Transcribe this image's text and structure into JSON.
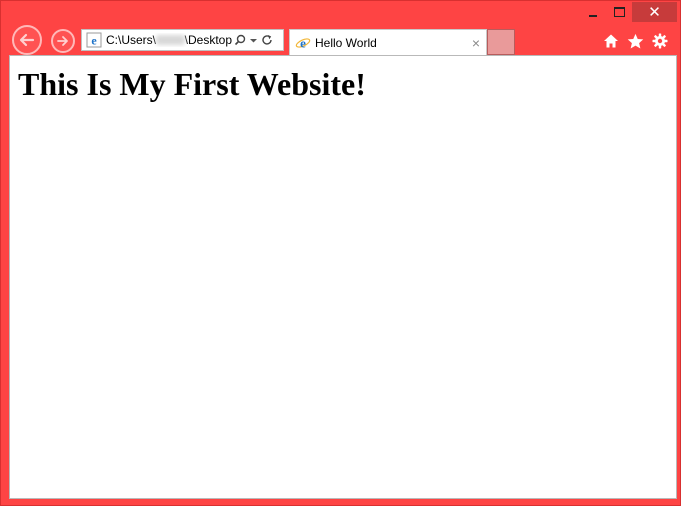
{
  "window": {
    "min_icon": "minimize-icon",
    "max_icon": "maximize-icon",
    "close_label": "✕"
  },
  "nav": {
    "back_icon": "back-arrow-icon",
    "forward_icon": "forward-arrow-icon"
  },
  "address": {
    "path_prefix": "C:\\Users\\",
    "path_suffix": "\\Desktop",
    "favicon": "ie-icon",
    "search_icon": "search-icon",
    "dropdown_icon": "chevron-down-icon",
    "refresh_icon": "refresh-icon"
  },
  "tab": {
    "title": "Hello World",
    "close_label": "×",
    "favicon": "ie-icon"
  },
  "toolbar": {
    "home_icon": "home-icon",
    "favorites_icon": "star-icon",
    "tools_icon": "gear-icon"
  },
  "page": {
    "heading": "This Is My First Website!"
  },
  "colors": {
    "frame": "#fe4444",
    "content_bg": "#ffffff",
    "accent": "#1e72c8"
  }
}
